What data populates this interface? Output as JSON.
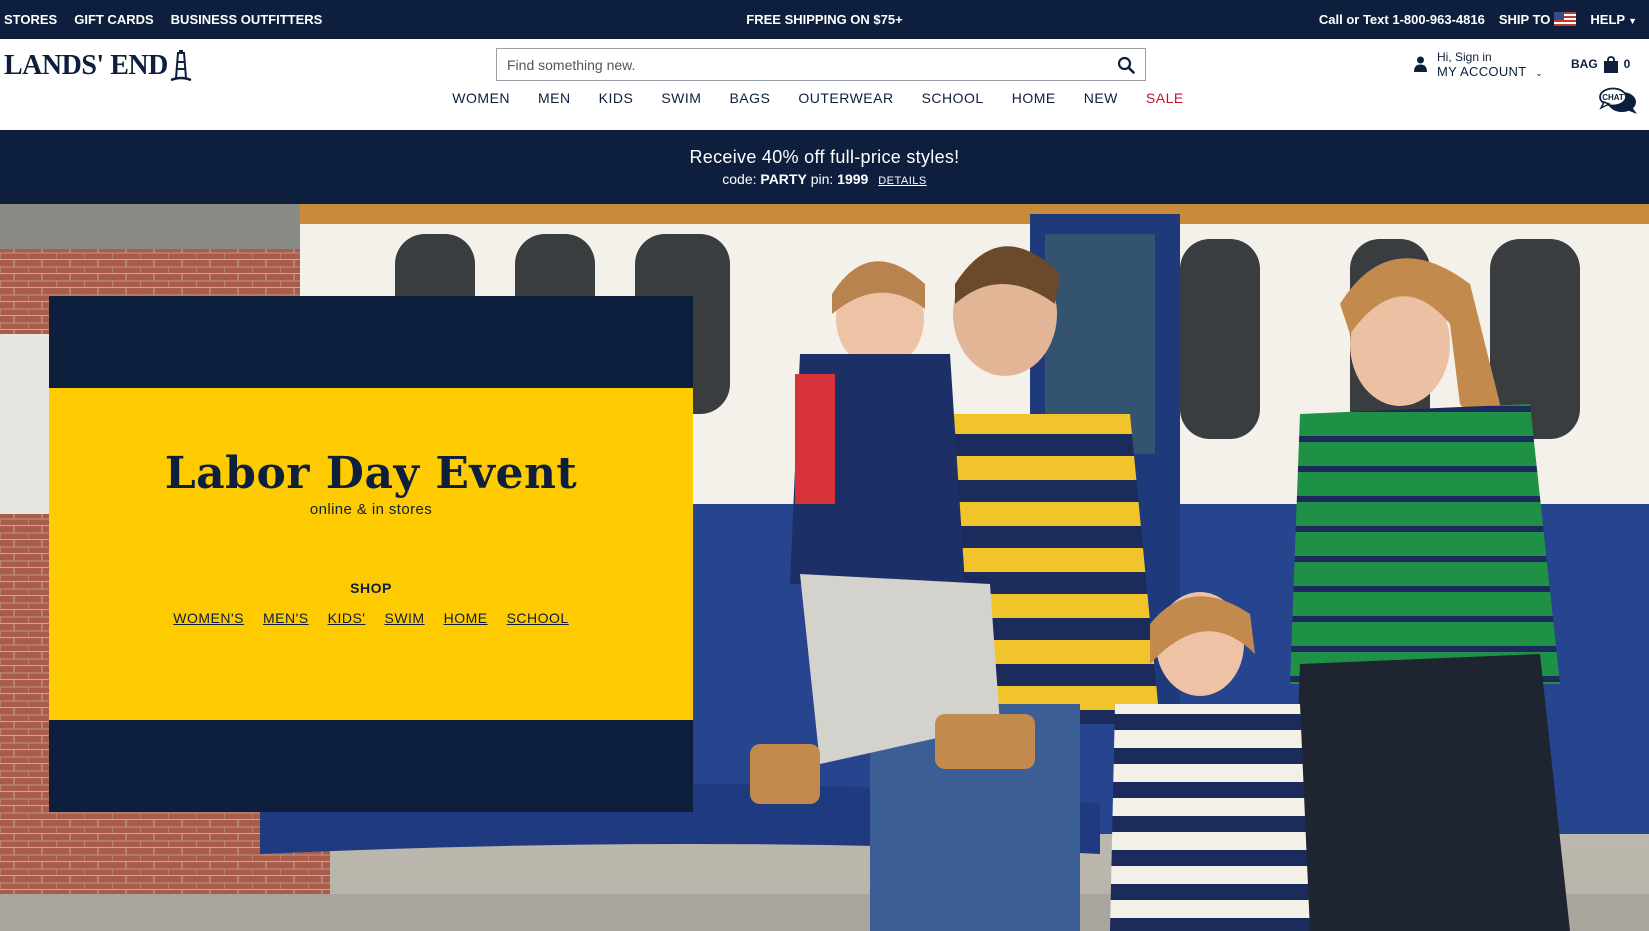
{
  "utility": {
    "left_links": [
      "STORES",
      "GIFT CARDS",
      "BUSINESS OUTFITTERS"
    ],
    "shipping": "FREE SHIPPING ON $75+",
    "phone": "Call or Text 1-800-963-4816",
    "ship_to": "SHIP TO",
    "help": "HELP"
  },
  "header": {
    "logo": "LANDS' END",
    "search_placeholder": "Find something new.",
    "account_hi": "Hi, Sign in",
    "account_label": "MY ACCOUNT",
    "bag_label": "BAG",
    "bag_count": "0",
    "chat_label": "CHAT"
  },
  "nav": {
    "items": [
      "WOMEN",
      "MEN",
      "KIDS",
      "SWIM",
      "BAGS",
      "OUTERWEAR",
      "SCHOOL",
      "HOME",
      "NEW",
      "SALE"
    ]
  },
  "promo": {
    "headline": "Receive 40% off full-price styles!",
    "code_prefix": "code:",
    "code": "PARTY",
    "pin_prefix": "pin:",
    "pin": "1999",
    "details": "DETAILS"
  },
  "hero": {
    "title": "Labor Day Event",
    "subtitle": "online & in stores",
    "shop_label": "SHOP",
    "links": [
      "WOMEN'S",
      "MEN'S",
      "KIDS'",
      "SWIM",
      "HOME",
      "SCHOOL"
    ]
  },
  "colors": {
    "navy": "#0d1f3c",
    "yellow": "#fdcb00",
    "sale_red": "#c8102e"
  }
}
